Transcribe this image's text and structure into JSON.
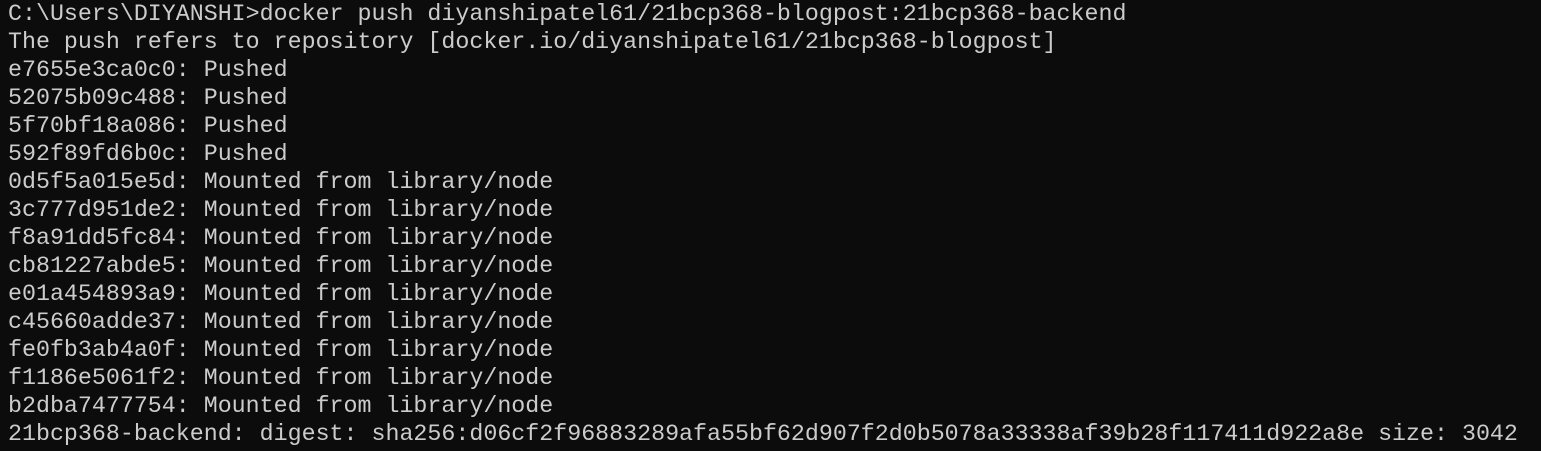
{
  "colors": {
    "background": "#0c0c0c",
    "foreground": "#cccccc"
  },
  "terminal": {
    "lines": [
      "C:\\Users\\DIYANSHI>docker push diyanshipatel61/21bcp368-blogpost:21bcp368-backend",
      "The push refers to repository [docker.io/diyanshipatel61/21bcp368-blogpost]",
      "e7655e3ca0c0: Pushed",
      "52075b09c488: Pushed",
      "5f70bf18a086: Pushed",
      "592f89fd6b0c: Pushed",
      "0d5f5a015e5d: Mounted from library/node",
      "3c777d951de2: Mounted from library/node",
      "f8a91dd5fc84: Mounted from library/node",
      "cb81227abde5: Mounted from library/node",
      "e01a454893a9: Mounted from library/node",
      "c45660adde37: Mounted from library/node",
      "fe0fb3ab4a0f: Mounted from library/node",
      "f1186e5061f2: Mounted from library/node",
      "b2dba7477754: Mounted from library/node",
      "21bcp368-backend: digest: sha256:d06cf2f96883289afa55bf62d907f2d0b5078a33338af39b28f117411d922a8e size: 3042"
    ]
  }
}
